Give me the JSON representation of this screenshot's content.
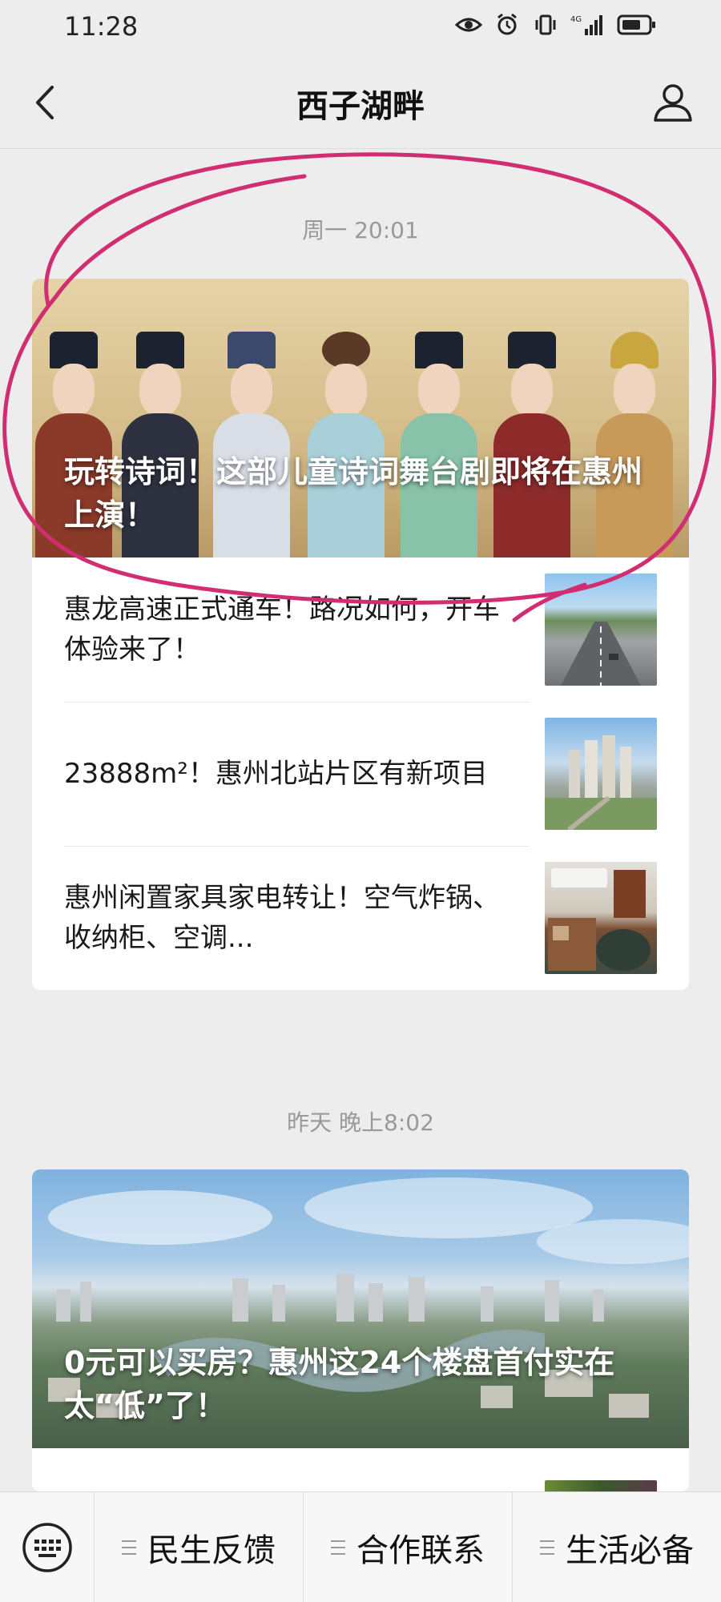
{
  "status_bar": {
    "time": "11:28",
    "network": "4G"
  },
  "nav": {
    "title": "西子湖畔"
  },
  "groups": [
    {
      "timestamp": "周一 20:01",
      "hero_title": "玩转诗词！这部儿童诗词舞台剧即将在惠州上演！",
      "items": [
        {
          "title": "惠龙高速正式通车！路况如何，开车体验来了！"
        },
        {
          "title": "23888m²！惠州北站片区有新项目"
        },
        {
          "title": "惠州闲置家具家电转让！空气炸锅、收纳柜、空调..."
        }
      ]
    },
    {
      "timestamp": "昨天 晚上8:02",
      "hero_title": "0元可以买房？惠州这24个楼盘首付实在太“低”了！"
    }
  ],
  "bottom_menu": {
    "items": [
      "民生反馈",
      "合作联系",
      "生活必备"
    ]
  },
  "colors": {
    "background": "#ededed",
    "annotation": "#d12e72",
    "card": "#ffffff"
  }
}
